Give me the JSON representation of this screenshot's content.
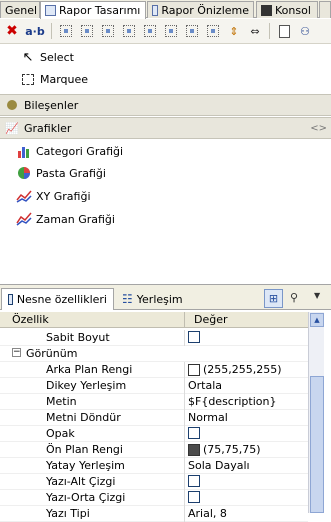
{
  "tabs": [
    {
      "label": "Genel",
      "active": false
    },
    {
      "label": "Rapor Tasarımı",
      "active": true
    },
    {
      "label": "Rapor Önizleme",
      "active": false
    },
    {
      "label": "Konsol",
      "active": false
    }
  ],
  "palette": {
    "select_label": "Select",
    "marquee_label": "Marquee",
    "components_section": "Bileşenler",
    "charts_section": "Grafikler",
    "charts": [
      {
        "label": "Categori Grafiği"
      },
      {
        "label": "Pasta Grafiği"
      },
      {
        "label": "XY Grafiği"
      },
      {
        "label": "Zaman Grafiği"
      }
    ]
  },
  "panel": {
    "tab_properties": "Nesne özellikleri",
    "tab_layout": "Yerleşim",
    "col_property": "Özellik",
    "col_value": "Değer"
  },
  "properties": [
    {
      "name": "Sabit Boyut",
      "value": "",
      "kind": "checkbox"
    },
    {
      "name": "Görünüm",
      "value": "",
      "kind": "group"
    },
    {
      "name": "Arka Plan Rengi",
      "value": "(255,255,255)",
      "kind": "color",
      "color": "#ffffff"
    },
    {
      "name": "Dikey Yerleşim",
      "value": "Ortala",
      "kind": "text"
    },
    {
      "name": "Metin",
      "value": "$F{description}",
      "kind": "text"
    },
    {
      "name": "Metni Döndür",
      "value": "Normal",
      "kind": "text"
    },
    {
      "name": "Opak",
      "value": "",
      "kind": "checkbox"
    },
    {
      "name": "Ön Plan Rengi",
      "value": "(75,75,75)",
      "kind": "color",
      "color": "#4b4b4b"
    },
    {
      "name": "Yatay Yerleşim",
      "value": "Sola Dayalı",
      "kind": "text"
    },
    {
      "name": "Yazı-Alt Çizgi",
      "value": "",
      "kind": "checkbox"
    },
    {
      "name": "Yazı-Orta Çizgi",
      "value": "",
      "kind": "checkbox"
    },
    {
      "name": "Yazı Tipi",
      "value": "Arial, 8",
      "kind": "text"
    }
  ]
}
